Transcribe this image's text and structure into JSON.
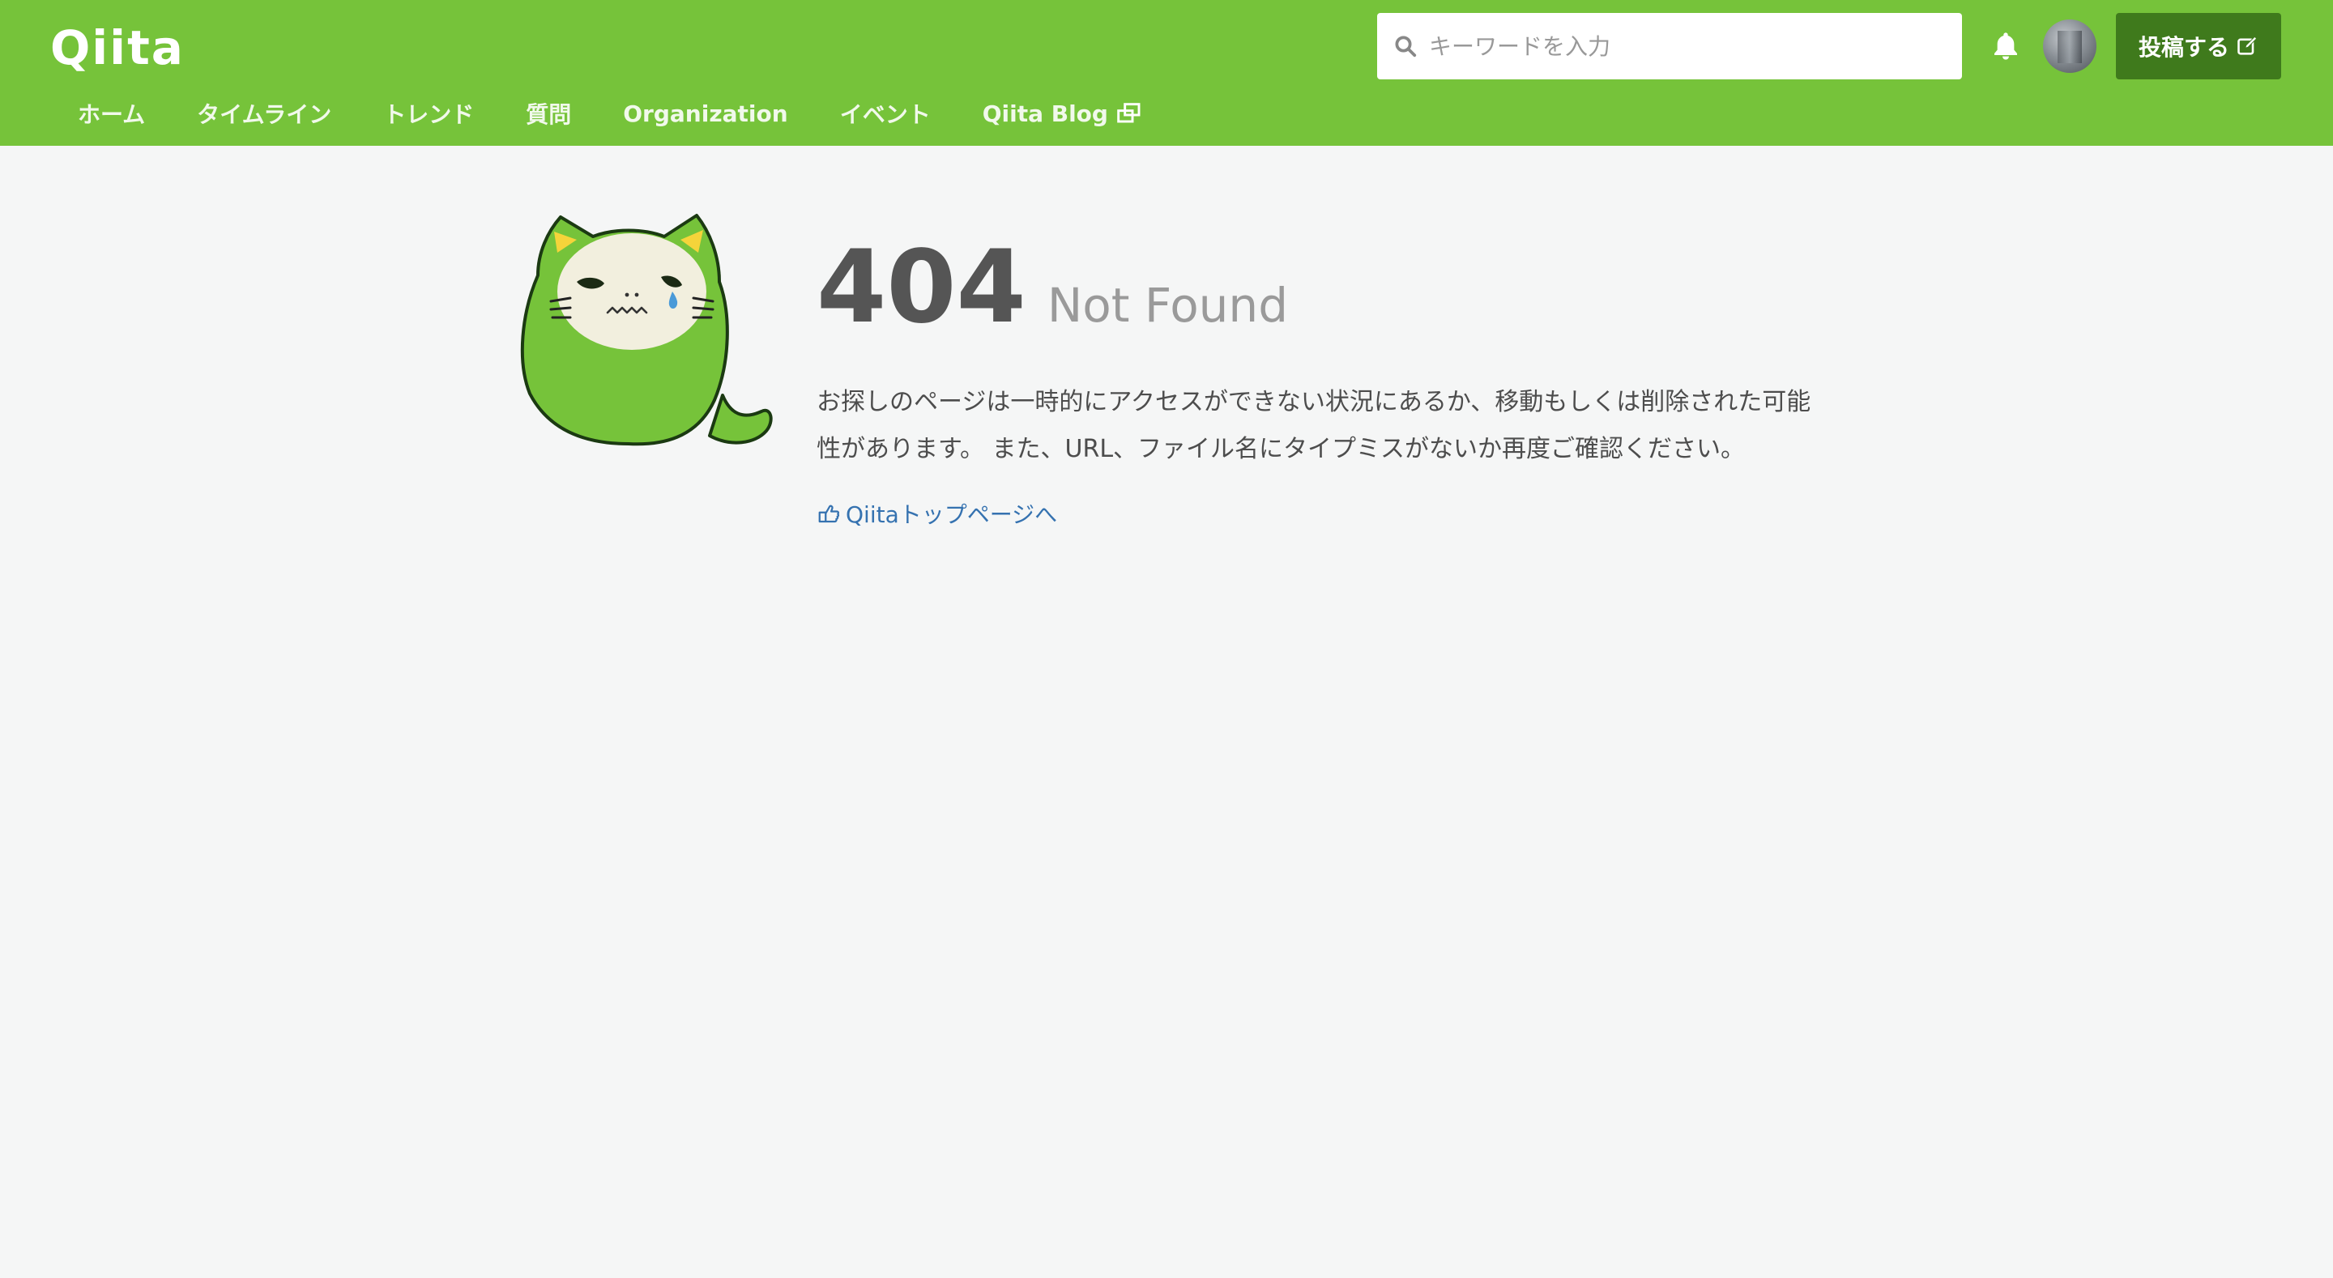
{
  "header": {
    "logo": "Qiita",
    "search": {
      "placeholder": "キーワードを入力",
      "value": ""
    },
    "post_button": "投稿する",
    "nav": [
      {
        "label": "ホーム"
      },
      {
        "label": "タイムライン"
      },
      {
        "label": "トレンド"
      },
      {
        "label": "質問"
      },
      {
        "label": "Organization"
      },
      {
        "label": "イベント"
      },
      {
        "label": "Qiita Blog"
      }
    ]
  },
  "error": {
    "code": "404",
    "title": "Not Found",
    "message": "お探しのページは一時的にアクセスができない状況にあるか、移動もしくは削除された可能性があります。 また、URL、ファイル名にタイプミスがないか再度ご確認ください。",
    "link_label": "Qiitaトップページへ"
  },
  "colors": {
    "brand": "#76c33a",
    "post_button": "#3f7a1c",
    "link": "#3572b0"
  }
}
